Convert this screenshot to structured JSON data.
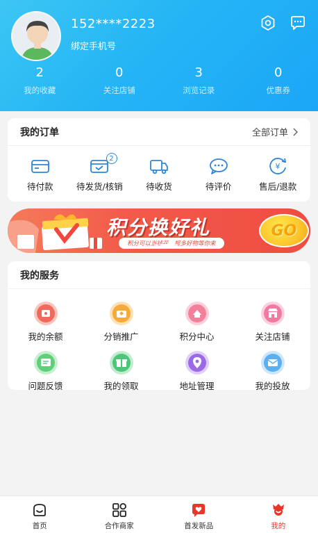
{
  "profile": {
    "phone": "152****2223",
    "bind_phone": "绑定手机号",
    "settings_icon": "settings-hex-icon",
    "message_icon": "message-icon"
  },
  "stats": [
    {
      "value": "2",
      "label": "我的收藏"
    },
    {
      "value": "0",
      "label": "关注店铺"
    },
    {
      "value": "3",
      "label": "浏览记录"
    },
    {
      "value": "0",
      "label": "优惠券"
    }
  ],
  "orders": {
    "title": "我的订单",
    "all": "全部订单",
    "items": [
      {
        "label": "待付款",
        "icon": "wallet-icon"
      },
      {
        "label": "待发货/核销",
        "icon": "package-icon",
        "badge": "2"
      },
      {
        "label": "待收货",
        "icon": "truck-icon"
      },
      {
        "label": "待评价",
        "icon": "comment-icon"
      },
      {
        "label": "售后/退款",
        "icon": "refund-icon"
      }
    ]
  },
  "banner": {
    "title": "积分换好礼",
    "subtitle": "积分可以当钱花，超多好物等你来",
    "go": "GO"
  },
  "services": {
    "title": "我的服务",
    "items": [
      {
        "label": "我的余额",
        "icon": "wallet-balance-icon",
        "color": "#f06a5c"
      },
      {
        "label": "分销推广",
        "icon": "distribution-icon",
        "color": "#f7a93a"
      },
      {
        "label": "积分中心",
        "icon": "points-icon",
        "color": "#f3809a"
      },
      {
        "label": "关注店铺",
        "icon": "store-icon",
        "color": "#f07aa0"
      },
      {
        "label": "问题反馈",
        "icon": "feedback-icon",
        "color": "#5fcf7a"
      },
      {
        "label": "我的领取",
        "icon": "gift-icon",
        "color": "#4fc57a"
      },
      {
        "label": "地址管理",
        "icon": "location-icon",
        "color": "#9c6ae6"
      },
      {
        "label": "我的投放",
        "icon": "mail-icon",
        "color": "#5ab0f0"
      }
    ]
  },
  "tabs": [
    {
      "label": "首页",
      "icon": "home-icon",
      "active": false
    },
    {
      "label": "合作商家",
      "icon": "grid-icon",
      "active": false
    },
    {
      "label": "首发新品",
      "icon": "heart-chat-icon",
      "active": false
    },
    {
      "label": "我的",
      "icon": "profile-icon",
      "active": true
    }
  ],
  "colors": {
    "header": "#25b5f5",
    "accent_blue": "#2b86d8",
    "active_tab": "#e8362a"
  }
}
